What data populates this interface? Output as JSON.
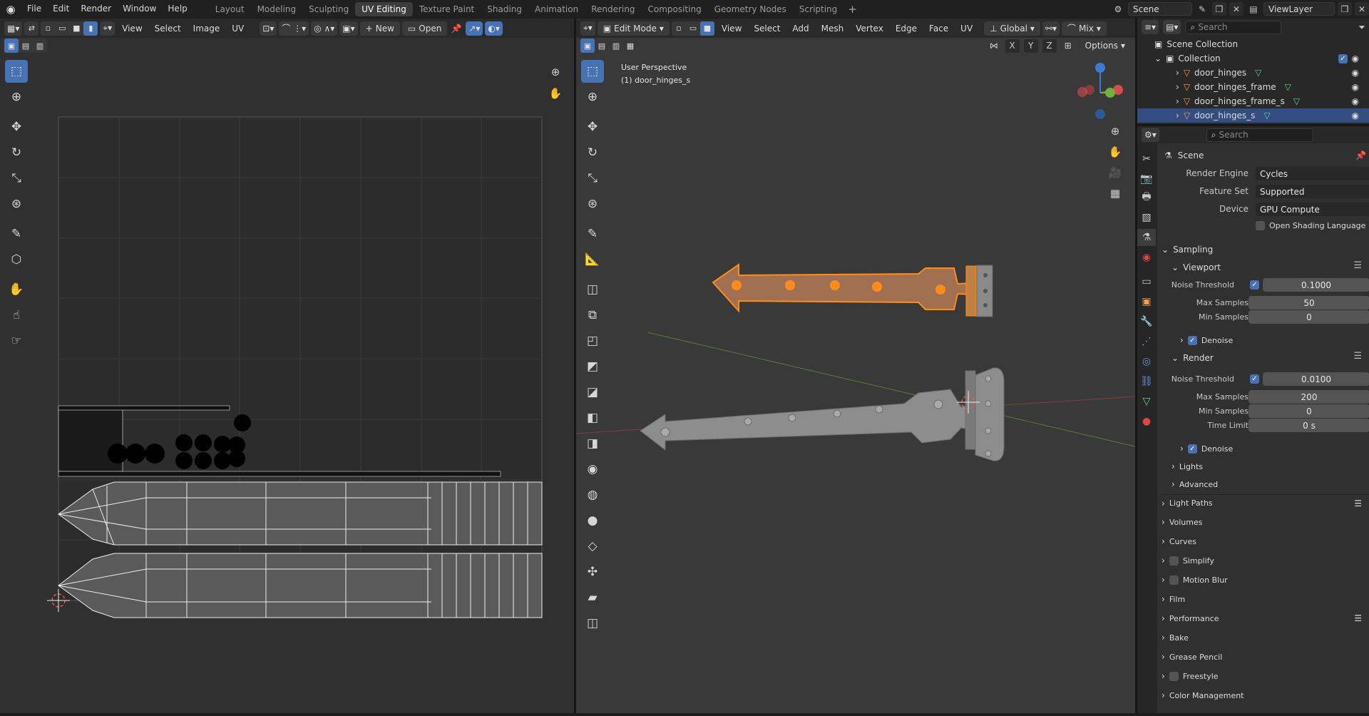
{
  "app_menu": [
    "File",
    "Edit",
    "Render",
    "Window",
    "Help"
  ],
  "workspaces": [
    "Layout",
    "Modeling",
    "Sculpting",
    "UV Editing",
    "Texture Paint",
    "Shading",
    "Animation",
    "Rendering",
    "Compositing",
    "Geometry Nodes",
    "Scripting"
  ],
  "active_workspace": "UV Editing",
  "scene_field": "Scene",
  "viewlayer_field": "ViewLayer",
  "uv_editor": {
    "menus": [
      "View",
      "Select",
      "Image",
      "UV"
    ],
    "new_label": "New",
    "open_label": "Open"
  },
  "viewport": {
    "mode": "Edit Mode",
    "menus": [
      "View",
      "Select",
      "Add",
      "Mesh",
      "Vertex",
      "Edge",
      "Face",
      "UV"
    ],
    "transform": "Global",
    "shading": "Mix",
    "options": "Options",
    "overlay_line1": "User Perspective",
    "overlay_line2": "(1) door_hinges_s",
    "axes": [
      "X",
      "Y",
      "Z"
    ]
  },
  "outliner": {
    "search_placeholder": "Search",
    "scene_collection": "Scene Collection",
    "collection": "Collection",
    "items": [
      "door_hinges",
      "door_hinges_frame",
      "door_hinges_frame_s",
      "door_hinges_s"
    ]
  },
  "properties": {
    "search_placeholder": "Search",
    "context": "Scene",
    "render_engine_label": "Render Engine",
    "render_engine": "Cycles",
    "feature_set_label": "Feature Set",
    "feature_set": "Supported",
    "device_label": "Device",
    "device": "GPU Compute",
    "osl_label": "Open Shading Language",
    "sampling": "Sampling",
    "viewport_sub": "Viewport",
    "noise_threshold_label": "Noise Threshold",
    "vp_noise_threshold": "0.1000",
    "max_samples_label": "Max Samples",
    "vp_max_samples": "50",
    "min_samples_label": "Min Samples",
    "vp_min_samples": "0",
    "denoise_label": "Denoise",
    "render_sub": "Render",
    "r_noise_threshold": "0.0100",
    "r_max_samples": "200",
    "r_min_samples": "0",
    "time_limit_label": "Time Limit",
    "r_time_limit": "0 s",
    "lights": "Lights",
    "advanced": "Advanced",
    "panels": [
      "Light Paths",
      "Volumes",
      "Curves",
      "Simplify",
      "Motion Blur",
      "Film",
      "Performance",
      "Bake",
      "Grease Pencil",
      "Freestyle",
      "Color Management"
    ]
  },
  "colors": {
    "accent": "#4772b3",
    "selected": "#ff8c1a",
    "bg": "#303030"
  }
}
